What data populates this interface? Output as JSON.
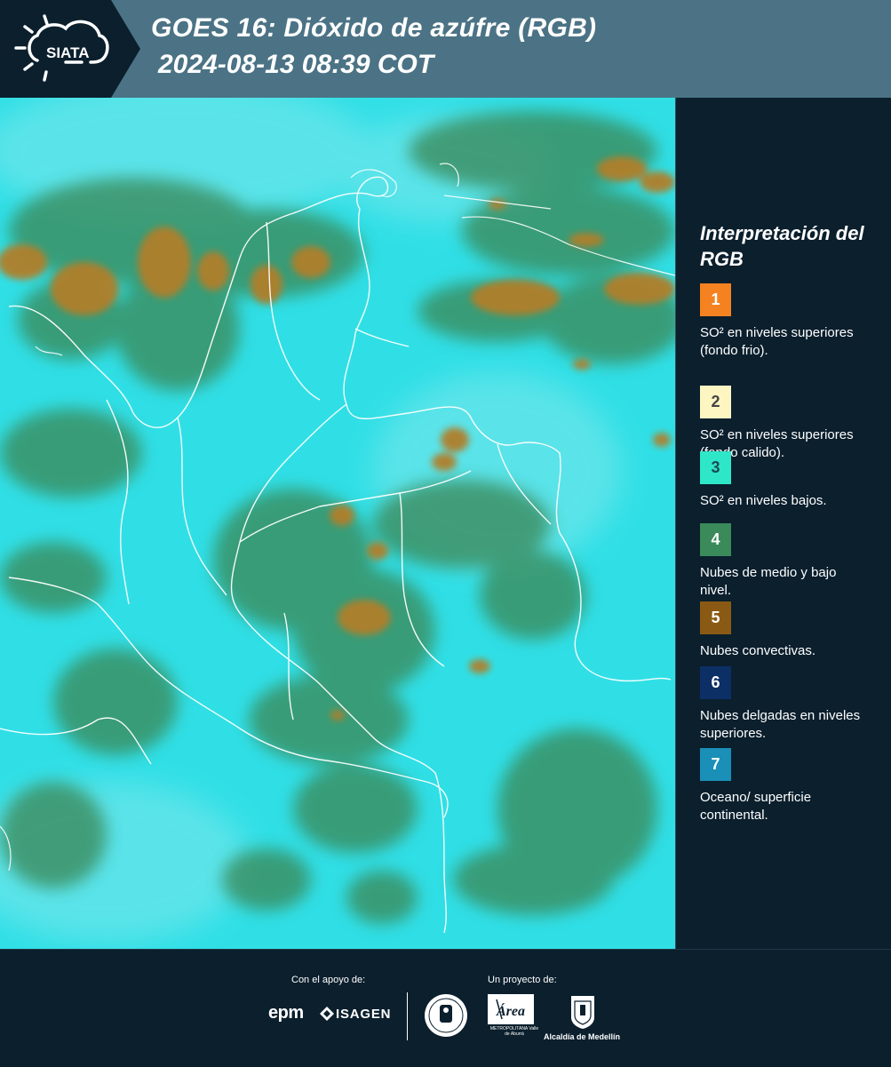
{
  "header": {
    "logo_text": "SIATA",
    "title": "GOES 16: Dióxido de azúfre (RGB)",
    "timestamp": "2024-08-13 08:39 COT"
  },
  "legend": {
    "title": "Interpretación del RGB",
    "items": [
      {
        "number": "1",
        "color": "#f58220",
        "number_color": "#ffffff",
        "text": "SO² en niveles superiores (fondo frio)."
      },
      {
        "number": "2",
        "color": "#fdf6c3",
        "number_color": "#444444",
        "text": "SO² en niveles superiores (fondo calido)."
      },
      {
        "number": "3",
        "color": "#2ee6c8",
        "number_color": "#1c4a55",
        "text": "SO² en niveles bajos."
      },
      {
        "number": "4",
        "color": "#3a8a5a",
        "number_color": "#ffffff",
        "text": "Nubes de medio y bajo nivel."
      },
      {
        "number": "5",
        "color": "#8a5a14",
        "number_color": "#ffffff",
        "text": "Nubes convectivas."
      },
      {
        "number": "6",
        "color": "#0c2f66",
        "number_color": "#ffffff",
        "text": "Nubes delgadas en niveles superiores."
      },
      {
        "number": "7",
        "color": "#1a8fb8",
        "number_color": "#ffffff",
        "text": "Oceano/ superficie continental."
      }
    ]
  },
  "map": {
    "ocean_color": "#2fe0e6",
    "cloud_mid_low_color": "#3a8a5a",
    "convective_color": "#a8782a",
    "border_color": "#ffffff"
  },
  "footer": {
    "support_label": "Con el apoyo de:",
    "project_label": "Un proyecto de:",
    "sponsors": [
      "epm",
      "ISAGEN"
    ],
    "partner_area_text": "Área",
    "partner_area_name": "METROPOLITANA Valle de Aburrá",
    "partner_alcaldia": "Alcaldía de Medellín"
  }
}
